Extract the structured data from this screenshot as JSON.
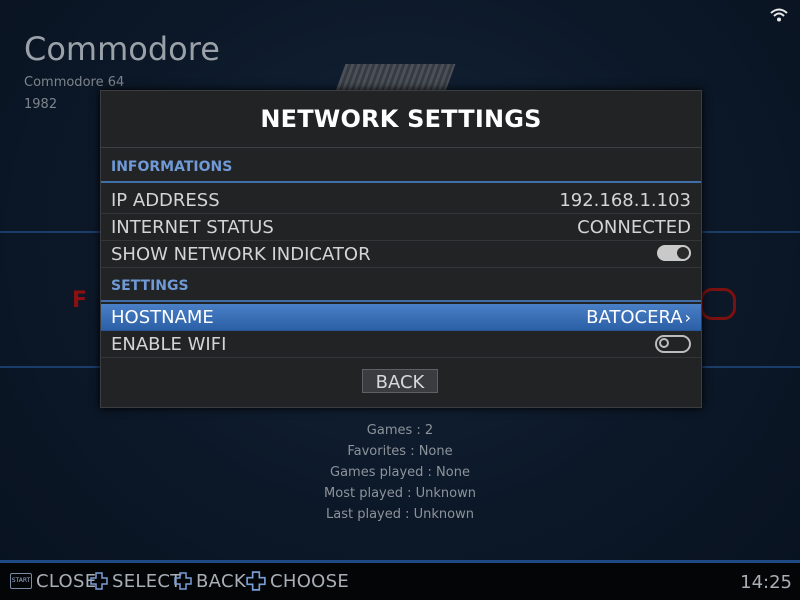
{
  "background": {
    "system_name": "Commodore",
    "system_model": "Commodore 64",
    "system_year": "1982"
  },
  "stats": {
    "games": "Games : 2",
    "favorites": "Favorites : None",
    "games_played": "Games played : None",
    "most_played": "Most played : Unknown",
    "last_played": "Last played : Unknown"
  },
  "dialog": {
    "title": "NETWORK SETTINGS",
    "sections": [
      {
        "label": "INFORMATIONS",
        "rows": [
          {
            "label": "IP ADDRESS",
            "value": "192.168.1.103"
          },
          {
            "label": "INTERNET STATUS",
            "value": "CONNECTED"
          },
          {
            "label": "SHOW NETWORK INDICATOR",
            "toggle": true
          }
        ]
      },
      {
        "label": "SETTINGS",
        "rows": [
          {
            "label": "HOSTNAME",
            "value": "BATOCERA",
            "selected": true
          },
          {
            "label": "ENABLE WIFI",
            "toggle": false
          }
        ]
      }
    ],
    "back_label": "BACK"
  },
  "footer": {
    "start_icon_text": "START",
    "hints": [
      {
        "icon": "start-button-icon",
        "label": "CLOSE"
      },
      {
        "icon": "dpad-icon",
        "label": "SELECT"
      },
      {
        "icon": "dpad-icon",
        "label": "BACK"
      },
      {
        "icon": "dpad-icon",
        "label": "CHOOSE"
      }
    ],
    "clock": "14:25"
  },
  "colors": {
    "accent": "#3f6ea8",
    "selected_row": "#3a6fb8",
    "section_label": "#6f9ad6",
    "dialog_bg": "#222325"
  }
}
